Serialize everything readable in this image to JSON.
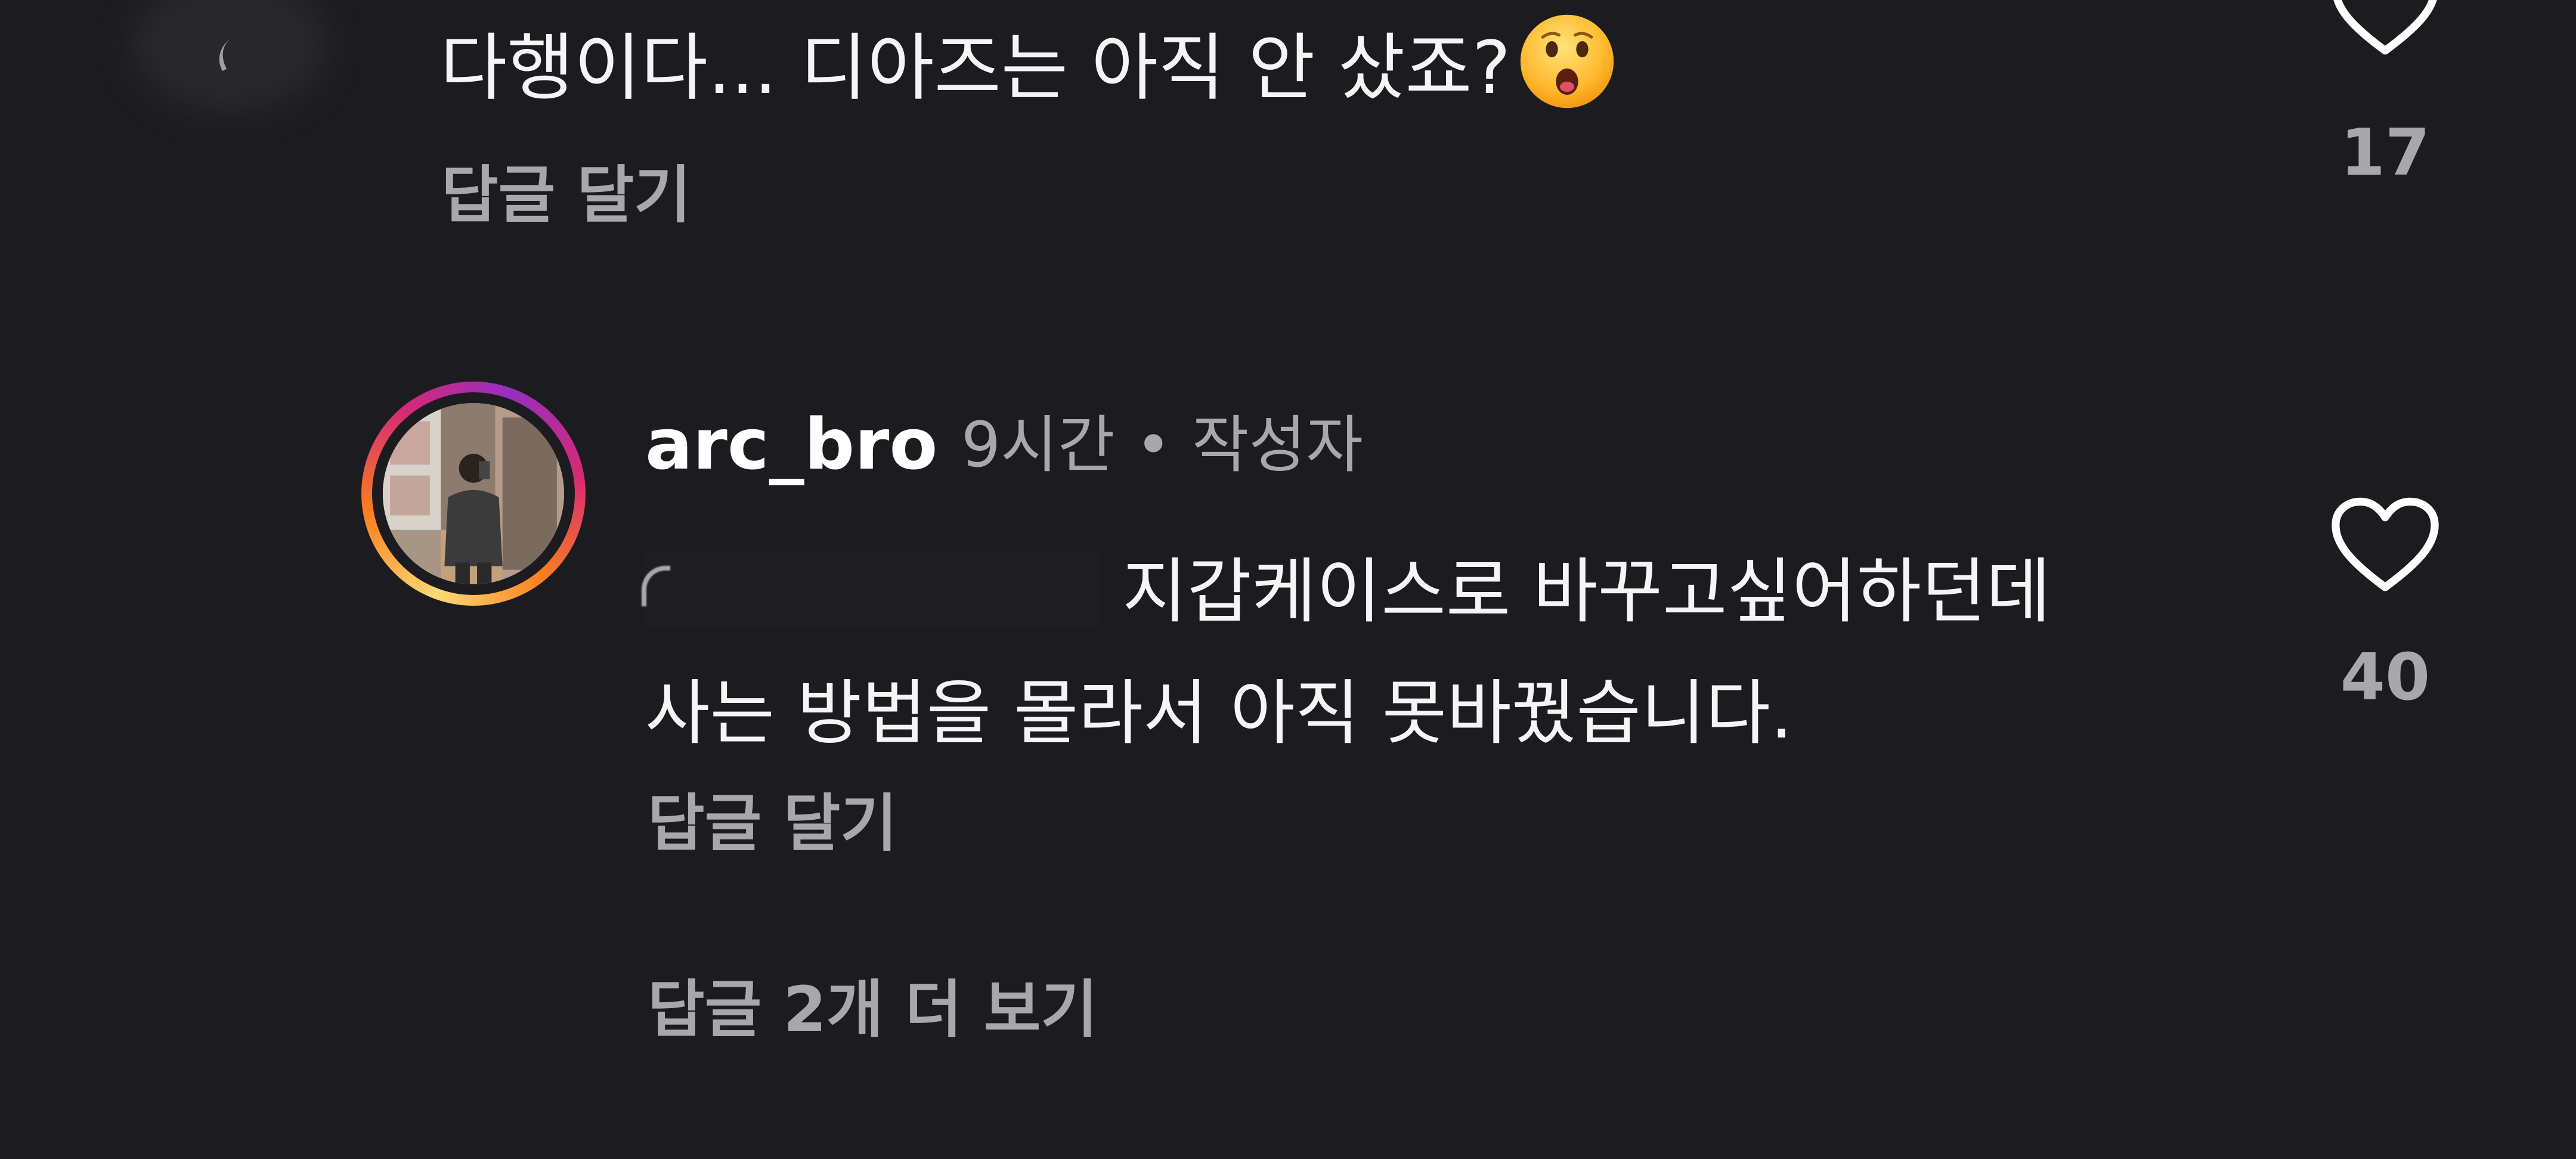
{
  "comments": [
    {
      "text": "다행이다... 디아즈는 아직 안 샀죠?",
      "emoji": "hushed-face-emoji",
      "reply_label": "답글 달기",
      "like_count": "17"
    },
    {
      "username": "arc_bro",
      "time": "9시간",
      "separator": "•",
      "author_badge": "작성자",
      "text_line1": "지갑케이스로 바꾸고싶어하던데",
      "text_line2": "사는 방법을 몰라서 아직 못바꿨습니다.",
      "reply_label": "답글 달기",
      "view_replies_label": "답글 2개 더 보기",
      "like_count": "40"
    }
  ],
  "icons": {
    "like": "heart-outline-icon"
  },
  "colors": {
    "background": "#1c1c20",
    "primary_text": "#ffffff",
    "secondary_text": "#a8a8ab",
    "story_ring": [
      "#feda75",
      "#fa7e1e",
      "#d62976",
      "#962fbf"
    ]
  }
}
